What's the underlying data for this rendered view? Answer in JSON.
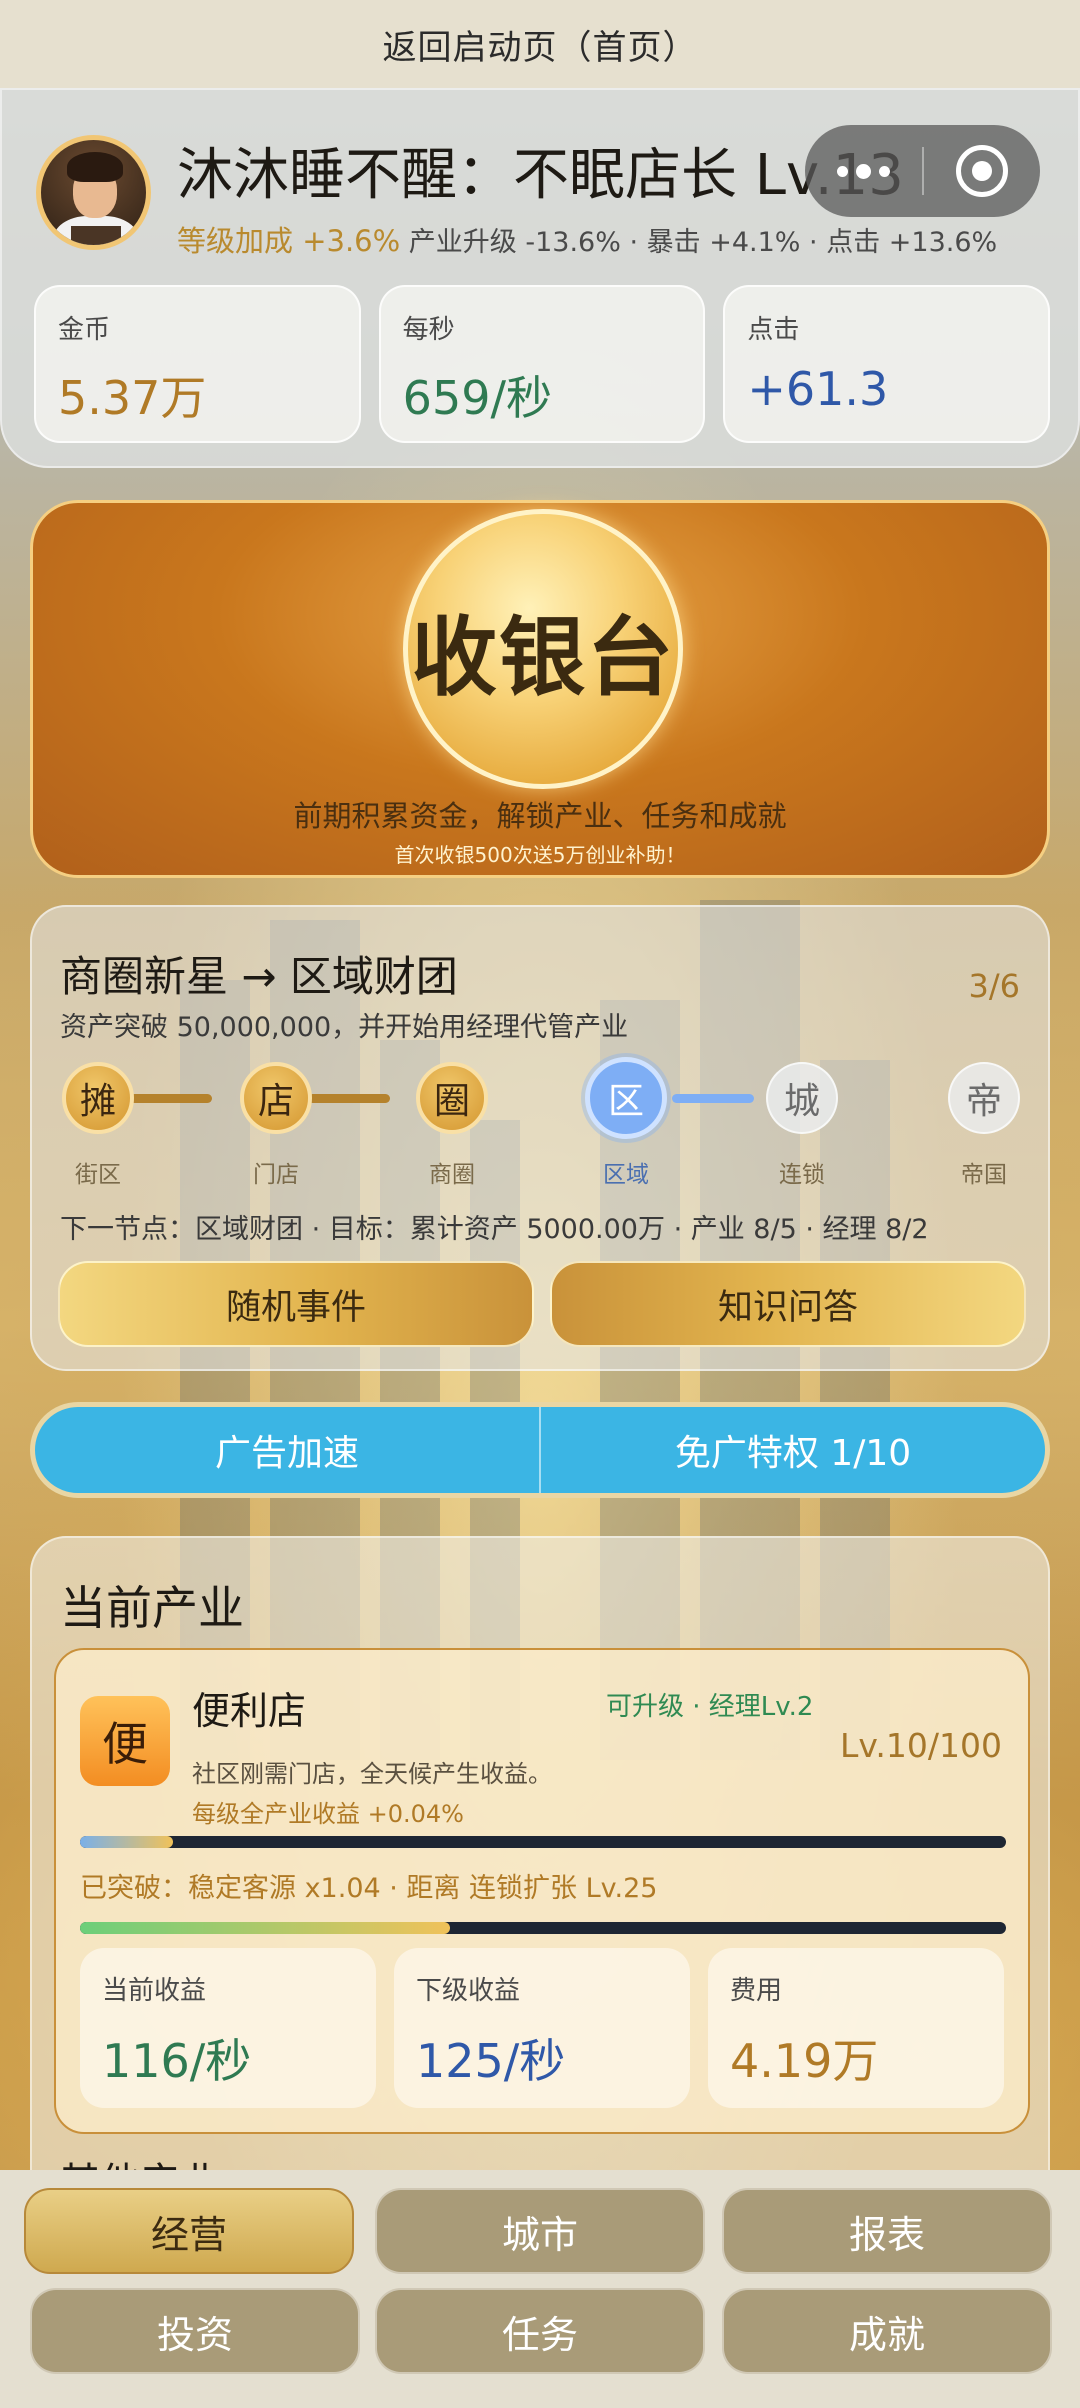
{
  "topbar": {
    "title": "返回启动页（首页）"
  },
  "player": {
    "title": "沐沐睡不醒：不眠店长 Lv.13",
    "level_bonus_label": "等级加成 +3.6%",
    "other_bonus": "产业升级 -13.6% · 暴击 +4.1% · 点击 +13.6%"
  },
  "stats": [
    {
      "label": "金币",
      "value": "5.37万"
    },
    {
      "label": "每秒",
      "value": "659/秒"
    },
    {
      "label": "点击",
      "value": "+61.3"
    }
  ],
  "cashier": {
    "button_label": "收银台",
    "subtitle": "前期积累资金，解锁产业、任务和成就",
    "note": "首次收银500次送5万创业补助！"
  },
  "progress": {
    "title": "商圈新星 → 区域财团",
    "desc": "资产突破 50,000,000，并开始用经理代管产业",
    "count": "3/6",
    "nodes": [
      {
        "glyph": "摊",
        "label": "街区",
        "state": "done"
      },
      {
        "glyph": "店",
        "label": "门店",
        "state": "done"
      },
      {
        "glyph": "圈",
        "label": "商圈",
        "state": "done"
      },
      {
        "glyph": "区",
        "label": "区域",
        "state": "current"
      },
      {
        "glyph": "城",
        "label": "连锁",
        "state": "todo"
      },
      {
        "glyph": "帝",
        "label": "帝国",
        "state": "todo"
      }
    ],
    "next_text": "下一节点：区域财团 · 目标：累计资产 5000.00万 · 产业 8/5 · 经理 8/2",
    "btn_event": "随机事件",
    "btn_quiz": "知识问答"
  },
  "ads": {
    "speed": "广告加速",
    "free": "免广特权 1/10"
  },
  "industry": {
    "heading": "当前产业",
    "card": {
      "icon_glyph": "便",
      "name": "便利店",
      "tag": "可升级 · 经理Lv.2",
      "level": "Lv.10/100",
      "desc": "社区刚需门店，全天候产生收益。",
      "bonus": "每级全产业收益 +0.04%",
      "level_progress": 0.1,
      "breakthrough": "已突破：稳定客源 x1.04 · 距离 连锁扩张 Lv.25",
      "breakthrough_progress": 0.4,
      "current_income_label": "当前收益",
      "current_income": "116/秒",
      "next_income_label": "下级收益",
      "next_income": "125/秒",
      "cost_label": "费用",
      "cost": "4.19万"
    },
    "other_heading": "其他产业"
  },
  "nav": {
    "active": "经营",
    "items": [
      "经营",
      "城市",
      "报表",
      "投资",
      "任务",
      "成就"
    ]
  },
  "colors": {
    "accent_gold": "#c9923a",
    "ad_blue": "#3bb5e4",
    "progress_blue": "#7eaef5"
  }
}
